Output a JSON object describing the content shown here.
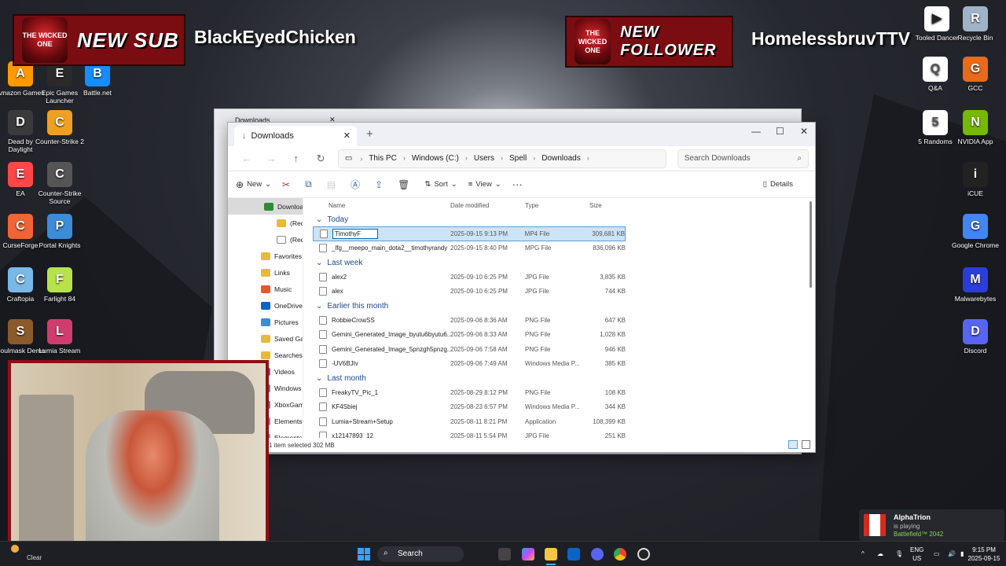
{
  "desktop": {
    "left_icons": [
      {
        "label": "Amazon Games",
        "icon": "amazon-games-icon",
        "color": "#ff9900"
      },
      {
        "label": "Epic Games Launcher",
        "icon": "epic-games-icon",
        "color": "#2a2a2a"
      },
      {
        "label": "Battle.net",
        "icon": "battlenet-icon",
        "color": "#148eff"
      },
      {
        "label": "Dead by Daylight",
        "icon": "dbd-icon",
        "color": "#3a3a3a"
      },
      {
        "label": "Counter-Strike 2",
        "icon": "cs2-icon",
        "color": "#f0a020"
      },
      {
        "label": "EA",
        "icon": "ea-icon",
        "color": "#ff4747"
      },
      {
        "label": "Counter-Strike Source",
        "icon": "css-icon",
        "color": "#555555"
      },
      {
        "label": "CurseForge",
        "icon": "curseforge-icon",
        "color": "#f16436"
      },
      {
        "label": "Portal Knights",
        "icon": "portal-knights-icon",
        "color": "#3d8bd9"
      },
      {
        "label": "Craftopia",
        "icon": "craftopia-icon",
        "color": "#7ab8e8"
      },
      {
        "label": "Farlight 84",
        "icon": "farlight-icon",
        "color": "#b7e34a"
      },
      {
        "label": "Soulmask Demo",
        "icon": "soulmask-icon",
        "color": "#8b5a2b"
      },
      {
        "label": "Lumia Stream",
        "icon": "lumia-icon",
        "color": "#d13c6e"
      }
    ],
    "right_icons": [
      {
        "label": "Recycle Bin",
        "icon": "recycle-bin-icon",
        "color": "#9fb4c8"
      },
      {
        "label": "Q&A",
        "icon": "document-icon",
        "color": "#ffffff"
      },
      {
        "label": "GCC",
        "icon": "gcc-icon",
        "color": "#e86a1a"
      },
      {
        "label": "5 Randoms",
        "icon": "document-icon",
        "color": "#ffffff"
      },
      {
        "label": "NVIDIA App",
        "icon": "nvidia-icon",
        "color": "#76b900"
      },
      {
        "label": "iCUE",
        "icon": "icue-icon",
        "color": "#222222"
      },
      {
        "label": "Google Chrome",
        "icon": "chrome-icon",
        "color": "#4285f4"
      },
      {
        "label": "Malwarebytes",
        "icon": "malwarebytes-icon",
        "color": "#2b3fd6"
      },
      {
        "label": "Discord",
        "icon": "discord-icon",
        "color": "#5865f2"
      }
    ],
    "partial_icon_label": "Tooled Dancer"
  },
  "overlays": {
    "new_sub_text": "NEW SUB",
    "sub_name": "BlackEyedChicken",
    "new_follower_text": "NEW FOLLOWER",
    "follower_name": "HomelessbruvTTV",
    "logo_text": "THE WICKED ONE"
  },
  "back_window": {
    "tab_title": "Downloads"
  },
  "explorer": {
    "tab_title": "Downloads",
    "breadcrumb": [
      "This PC",
      "Windows (C:)",
      "Users",
      "Spell",
      "Downloads"
    ],
    "search_placeholder": "Search Downloads",
    "toolbar": {
      "new": "New",
      "sort": "Sort",
      "view": "View",
      "details": "Details"
    },
    "sidebar": [
      {
        "label": "Downloads",
        "color": "#2f8a3a"
      },
      {
        "label": "(Red Fire)",
        "color": "#e8b93a"
      },
      {
        "label": "(Red Fire)",
        "color": "#ffffff"
      },
      {
        "label": "Favorites",
        "color": "#e8b93a"
      },
      {
        "label": "Links",
        "color": "#e8b93a"
      },
      {
        "label": "Music",
        "color": "#e05a2a"
      },
      {
        "label": "OneDrive",
        "color": "#0a64c8"
      },
      {
        "label": "Pictures",
        "color": "#3d8bd9"
      },
      {
        "label": "Saved Games",
        "color": "#e8b93a"
      },
      {
        "label": "Searches",
        "color": "#e8b93a"
      },
      {
        "label": "Videos",
        "color": "#7a4fc8"
      },
      {
        "label": "Windows",
        "color": "#3d8bd9"
      },
      {
        "label": "XboxGames",
        "color": "#3d8bd9"
      },
      {
        "label": "Elements SE (D:)",
        "color": "#888888"
      },
      {
        "label": "Elements SE (D:)",
        "color": "#888888"
      }
    ],
    "columns": {
      "name": "Name",
      "date": "Date modified",
      "type": "Type",
      "size": "Size"
    },
    "groups": [
      {
        "label": "Today",
        "files": [
          {
            "name": "TimothyF",
            "date": "2025-09-15 9:13 PM",
            "type": "MP4 File",
            "size": "309,681 KB",
            "selected": true,
            "renaming": true
          },
          {
            "name": "_lfg__meepo_main_dota2__timothyrandy",
            "date": "2025-09-15 8:40 PM",
            "type": "MPG File",
            "size": "836,096 KB"
          }
        ]
      },
      {
        "label": "Last week",
        "files": [
          {
            "name": "alex2",
            "date": "2025-09-10 6:25 PM",
            "type": "JPG File",
            "size": "3,835 KB"
          },
          {
            "name": "alex",
            "date": "2025-09-10 6:25 PM",
            "type": "JPG File",
            "size": "744 KB"
          }
        ]
      },
      {
        "label": "Earlier this month",
        "files": [
          {
            "name": "RobbieCrowSS",
            "date": "2025-09-06 8:36 AM",
            "type": "PNG File",
            "size": "647 KB"
          },
          {
            "name": "Gemini_Generated_Image_byutu6byutu6...",
            "date": "2025-09-06 8:33 AM",
            "type": "PNG File",
            "size": "1,028 KB"
          },
          {
            "name": "Gemini_Generated_Image_5pnzgh5pnzg...",
            "date": "2025-09-06 7:58 AM",
            "type": "PNG File",
            "size": "946 KB"
          },
          {
            "name": "-UV6BJIv",
            "date": "2025-09-06 7:49 AM",
            "type": "Windows Media P...",
            "size": "385 KB"
          }
        ]
      },
      {
        "label": "Last month",
        "files": [
          {
            "name": "FreakyTV_Pic_1",
            "date": "2025-08-29 8:12 PM",
            "type": "PNG File",
            "size": "108 KB"
          },
          {
            "name": "KF4Sbiej",
            "date": "2025-08-23 6:57 PM",
            "type": "Windows Media P...",
            "size": "344 KB"
          },
          {
            "name": "Lumia+Stream+Setup",
            "date": "2025-08-11 8:21 PM",
            "type": "Application",
            "size": "108,399 KB"
          },
          {
            "name": "x12147893_12",
            "date": "2025-08-11 5:54 PM",
            "type": "JPG File",
            "size": "251 KB"
          }
        ]
      }
    ],
    "status": "1 item selected  302 MB"
  },
  "notification": {
    "user": "AlphaTrion",
    "line1": "is playing",
    "game": "Battlefield™ 2042"
  },
  "taskbar": {
    "search_label": "Search",
    "weather": "Clear",
    "lang": "ENG",
    "region": "US",
    "time": "9:15 PM",
    "date": "2025-09-15"
  }
}
